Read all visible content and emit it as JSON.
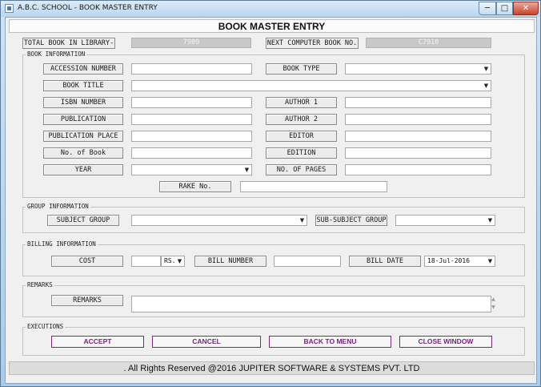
{
  "window": {
    "title": "A.B.C. SCHOOL - BOOK MASTER ENTRY",
    "min_glyph": "─",
    "max_glyph": "□",
    "close_glyph": "✕"
  },
  "header": {
    "title": "BOOK MASTER ENTRY"
  },
  "summary": {
    "total_label": "TOTAL BOOK IN LIBRARY-",
    "total_value": "7909",
    "next_label": "NEXT COMPUTER BOOK NO.",
    "next_value": "C7910"
  },
  "book_info": {
    "legend": "BOOK INFORMATION",
    "accession_label": "ACCESSION NUMBER",
    "book_type_label": "BOOK TYPE",
    "book_title_label": "BOOK TITLE",
    "isbn_label": "ISBN NUMBER",
    "author1_label": "AUTHOR 1",
    "publication_label": "PUBLICATION",
    "author2_label": "AUTHOR 2",
    "publication_place_label": "PUBLICATION PLACE",
    "editor_label": "EDITOR",
    "no_of_book_label": "No. of Book",
    "edition_label": "EDITION",
    "year_label": "YEAR",
    "no_of_pages_label": "NO. OF PAGES",
    "rake_label": "RAKE No."
  },
  "group_info": {
    "legend": "GROUP INFORMATION",
    "subject_group_label": "SUBJECT GROUP",
    "sub_subject_group_label": "SUB-SUBJECT GROUP"
  },
  "billing_info": {
    "legend": "BILLING INFORMATION",
    "cost_label": "COST",
    "currency_value": "RS.",
    "bill_number_label": "BILL NUMBER",
    "bill_date_label": "BILL DATE",
    "bill_date_value": "18-Jul-2016"
  },
  "remarks": {
    "legend": "REMARKS",
    "label": "REMARKS"
  },
  "executions": {
    "legend": "EXECUTIONS",
    "accept": "ACCEPT",
    "cancel": "CANCEL",
    "back": "BACK TO MENU",
    "close": "CLOSE WINDOW"
  },
  "footer": {
    "text": ". All Rights Reserved @2016 JUPITER SOFTWARE & SYSTEMS PVT. LTD"
  },
  "colors": {
    "button_text": "#7a1f7a",
    "readonly_field": "#c8c8c8"
  },
  "icons": {
    "dropdown": "▼",
    "scroll_up": "▲",
    "scroll_down": "▼"
  }
}
